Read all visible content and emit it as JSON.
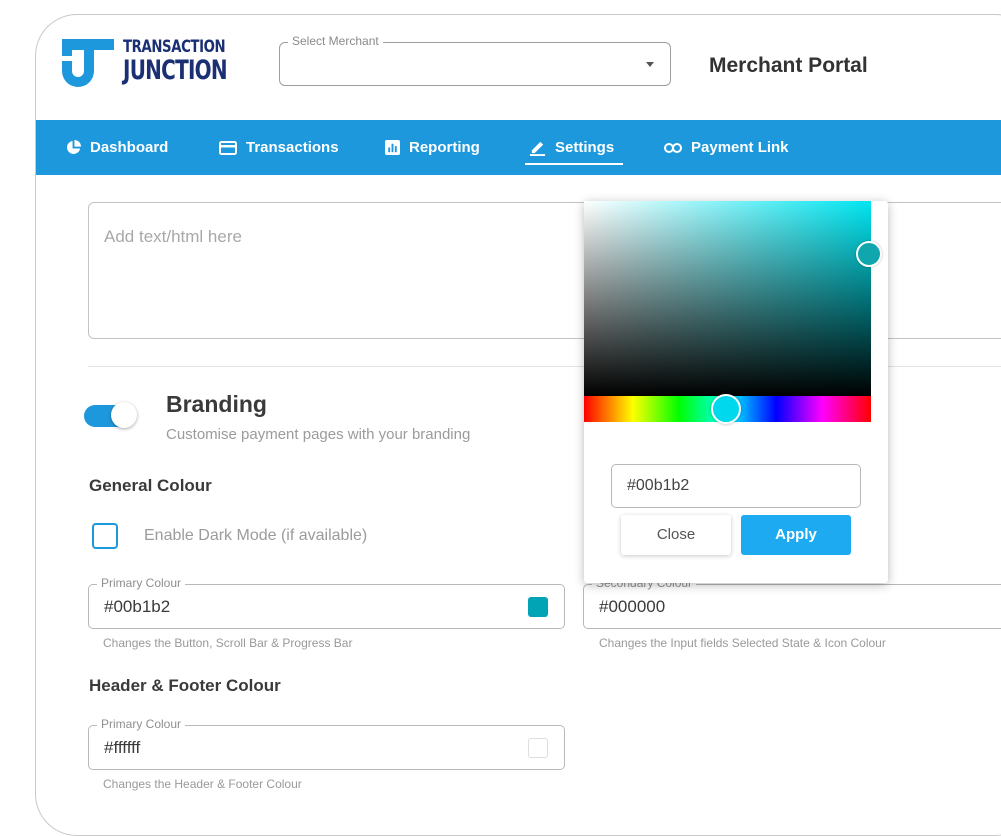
{
  "header": {
    "logo": {
      "line1": "TRANSACTION",
      "line2": "JUNCTION",
      "brand_color": "#1b2f73",
      "mark_color": "#1d98dc"
    },
    "merchant_select": {
      "label": "Select Merchant",
      "value": ""
    },
    "title": "Merchant Portal"
  },
  "nav": {
    "background": "#1d98dc",
    "items": [
      {
        "label": "Dashboard",
        "icon": "pie-chart-icon"
      },
      {
        "label": "Transactions",
        "icon": "credit-card-icon"
      },
      {
        "label": "Reporting",
        "icon": "bar-chart-icon"
      },
      {
        "label": "Settings",
        "icon": "pencil-icon",
        "active": true
      },
      {
        "label": "Payment Link",
        "icon": "link-icon"
      }
    ]
  },
  "editor": {
    "placeholder": "Add text/html here"
  },
  "branding": {
    "enabled": true,
    "title": "Branding",
    "subtitle": "Customise payment pages with your branding"
  },
  "general_colour": {
    "heading": "General Colour",
    "dark_mode": {
      "label": "Enable Dark Mode (if available)",
      "checked": false
    },
    "primary": {
      "label": "Primary Colour",
      "value": "#00b1b2",
      "helper": "Changes the Button, Scroll Bar & Progress Bar"
    },
    "secondary": {
      "label": "Secondary Colour",
      "value": "#000000",
      "helper": "Changes the Input fields Selected State & Icon Colour"
    }
  },
  "header_footer_colour": {
    "heading": "Header & Footer Colour",
    "primary": {
      "label": "Primary Colour",
      "value": "#ffffff",
      "helper": "Changes the Header & Footer Colour"
    }
  },
  "color_picker": {
    "hex": "#00b1b2",
    "close_label": "Close",
    "apply_label": "Apply",
    "apply_color": "#1eaaf0"
  }
}
